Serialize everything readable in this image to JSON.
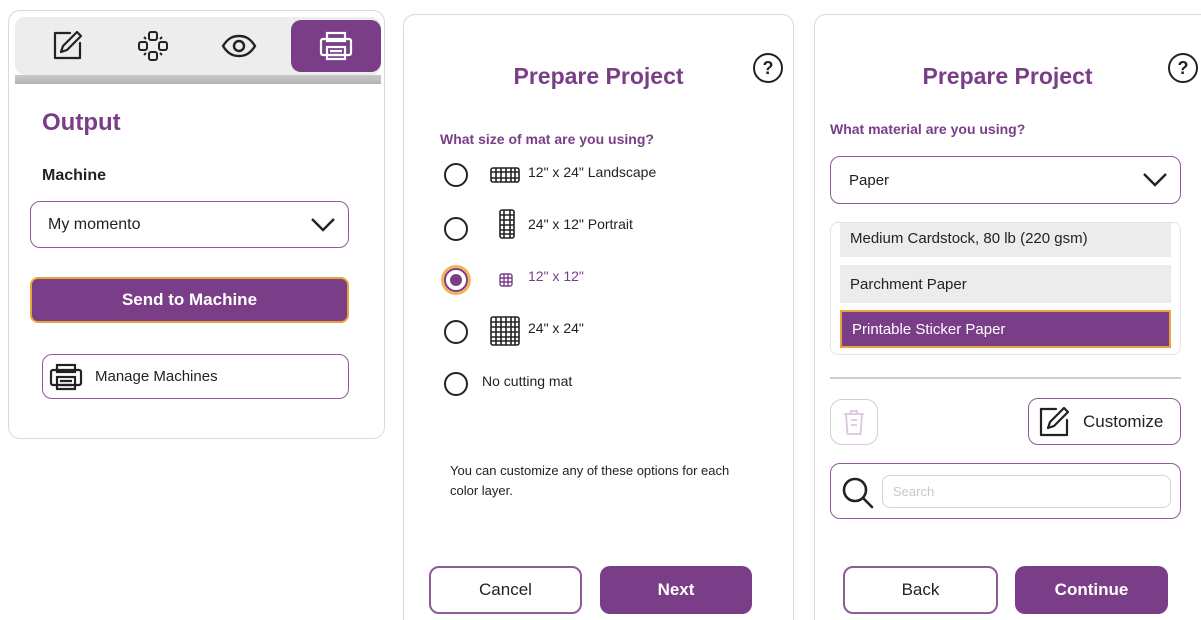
{
  "toolbar": {
    "tools": [
      {
        "icon": "edit-icon",
        "active": false
      },
      {
        "icon": "layers-icon",
        "active": false
      },
      {
        "icon": "eye-icon",
        "active": false
      },
      {
        "icon": "printer-icon",
        "active": true
      }
    ]
  },
  "output_panel": {
    "title": "Output",
    "machine_label": "Machine",
    "machine_value": "My momento",
    "send_label": "Send to Machine",
    "manage_label": "Manage Machines"
  },
  "mat_panel": {
    "title": "Prepare Project",
    "help": "?",
    "question": "What size of mat are you using?",
    "options": [
      {
        "label": "12\" x 24\" Landscape",
        "icon": "landscape-mat-icon",
        "selected": false
      },
      {
        "label": "24\" x 12\" Portrait",
        "icon": "portrait-mat-icon",
        "selected": false
      },
      {
        "label": "12\" x 12\"",
        "icon": "small-mat-icon",
        "selected": true
      },
      {
        "label": "24\" x 24\"",
        "icon": "large-mat-icon",
        "selected": false
      },
      {
        "label": "No cutting mat",
        "icon": "",
        "selected": false
      }
    ],
    "note": "You can customize any of these options for each color layer.",
    "cancel_label": "Cancel",
    "next_label": "Next"
  },
  "material_panel": {
    "title": "Prepare Project",
    "help": "?",
    "question": "What material are you using?",
    "selected_category": "Paper",
    "materials": [
      {
        "label": "Medium Cardstock, 80 lb (220 gsm)",
        "selected": false
      },
      {
        "label": "Parchment Paper",
        "selected": false
      },
      {
        "label": "Printable Sticker Paper",
        "selected": true
      }
    ],
    "customize_label": "Customize",
    "search_placeholder": "Search",
    "back_label": "Back",
    "continue_label": "Continue"
  },
  "colors": {
    "accent": "#7a3e88",
    "highlight": "#e8a43b"
  }
}
